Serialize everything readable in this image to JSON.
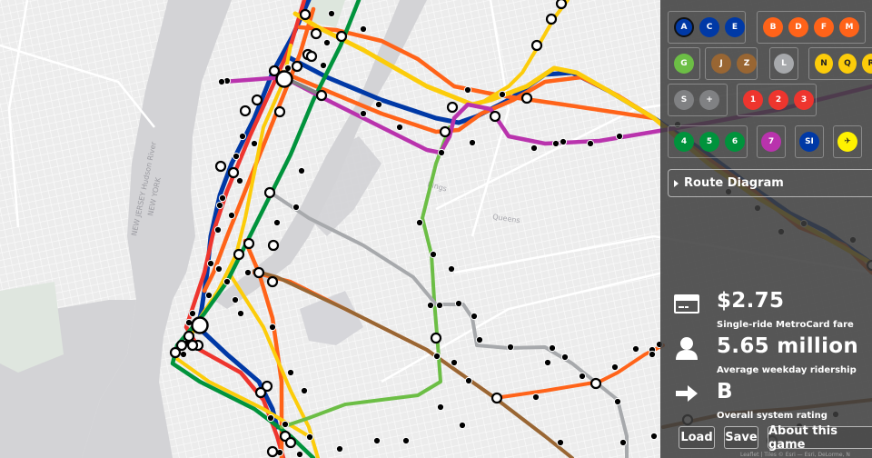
{
  "map": {
    "water_labels": [
      "NEW JERSEY Hudson River",
      "NEW YORK"
    ],
    "area_labels": [
      "Kings",
      "Queens"
    ],
    "line_colors": {
      "ace": "#0039a6",
      "bdfm": "#ff6319",
      "g": "#6cbe45",
      "jz": "#996633",
      "l": "#a7a9ac",
      "nqr": "#fccc0a",
      "s": "#808183",
      "123": "#ee352e",
      "456": "#00933c",
      "7": "#b933ad"
    }
  },
  "lines": {
    "groups": [
      {
        "name": "ace",
        "bullets": [
          {
            "label": "A",
            "color": "#0039a6",
            "text": "#fff",
            "selected": true
          },
          {
            "label": "C",
            "color": "#0039a6",
            "text": "#fff"
          },
          {
            "label": "E",
            "color": "#0039a6",
            "text": "#fff"
          }
        ]
      },
      {
        "name": "bdfm",
        "bullets": [
          {
            "label": "B",
            "color": "#ff6319",
            "text": "#fff"
          },
          {
            "label": "D",
            "color": "#ff6319",
            "text": "#fff"
          },
          {
            "label": "F",
            "color": "#ff6319",
            "text": "#fff"
          },
          {
            "label": "M",
            "color": "#ff6319",
            "text": "#fff"
          }
        ]
      },
      {
        "name": "g",
        "bullets": [
          {
            "label": "G",
            "color": "#6cbe45",
            "text": "#fff"
          }
        ]
      },
      {
        "name": "jz",
        "bullets": [
          {
            "label": "J",
            "color": "#996633",
            "text": "#fff"
          },
          {
            "label": "Z",
            "color": "#996633",
            "text": "#fff"
          }
        ]
      },
      {
        "name": "l",
        "bullets": [
          {
            "label": "L",
            "color": "#a7a9ac",
            "text": "#fff"
          }
        ]
      },
      {
        "name": "nqr",
        "bullets": [
          {
            "label": "N",
            "color": "#fccc0a",
            "text": "#222"
          },
          {
            "label": "Q",
            "color": "#fccc0a",
            "text": "#222"
          },
          {
            "label": "R",
            "color": "#fccc0a",
            "text": "#222"
          }
        ]
      },
      {
        "name": "s",
        "bullets": [
          {
            "label": "S",
            "color": "#808183",
            "text": "#fff"
          },
          {
            "label": "+",
            "color": "#808183",
            "text": "#fff"
          }
        ]
      },
      {
        "name": "123",
        "bullets": [
          {
            "label": "1",
            "color": "#ee352e",
            "text": "#fff"
          },
          {
            "label": "2",
            "color": "#ee352e",
            "text": "#fff"
          },
          {
            "label": "3",
            "color": "#ee352e",
            "text": "#fff"
          }
        ]
      },
      {
        "name": "456",
        "bullets": [
          {
            "label": "4",
            "color": "#00933c",
            "text": "#fff"
          },
          {
            "label": "5",
            "color": "#00933c",
            "text": "#fff"
          },
          {
            "label": "6",
            "color": "#00933c",
            "text": "#fff"
          }
        ]
      },
      {
        "name": "7",
        "bullets": [
          {
            "label": "7",
            "color": "#b933ad",
            "text": "#fff"
          }
        ]
      },
      {
        "name": "si",
        "bullets": [
          {
            "label": "SI",
            "color": "#0039a6",
            "text": "#fff"
          }
        ]
      },
      {
        "name": "airport",
        "bullets": [
          {
            "label": "✈",
            "color": "#fff200",
            "text": "#222"
          }
        ]
      }
    ]
  },
  "route_diagram": {
    "label": "Route Diagram"
  },
  "stats": {
    "fare": {
      "value": "$2.75",
      "label": "Single-ride MetroCard fare",
      "icon": "credit-card-icon"
    },
    "ridership": {
      "value": "5.65 million",
      "label": "Average weekday ridership",
      "icon": "user-icon"
    },
    "rating": {
      "value": "B",
      "label": "Overall system rating",
      "icon": "arrow-right-icon"
    }
  },
  "buttons": {
    "load": "Load",
    "save": "Save",
    "about": "About this game"
  },
  "attribution": "Leaflet | Tiles © Esri — Esri, DeLorme, N"
}
